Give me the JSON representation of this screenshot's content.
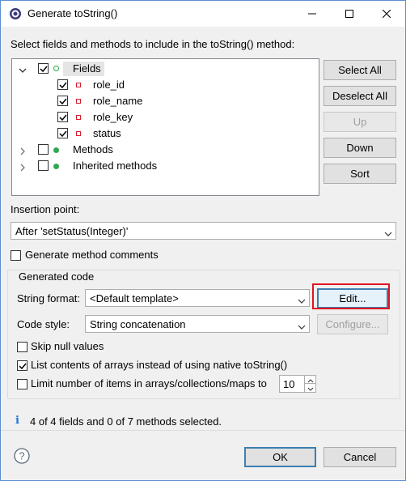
{
  "window": {
    "title": "Generate toString()"
  },
  "instructions": "Select fields and methods to include in the toString() method:",
  "tree": {
    "fields": {
      "label": "Fields",
      "checked": true,
      "expanded": true,
      "children": [
        {
          "label": "role_id",
          "checked": true
        },
        {
          "label": "role_name",
          "checked": true
        },
        {
          "label": "role_key",
          "checked": true
        },
        {
          "label": "status",
          "checked": true
        }
      ]
    },
    "methods": {
      "label": "Methods",
      "checked": false,
      "expanded": false
    },
    "inherited": {
      "label": "Inherited methods",
      "checked": false,
      "expanded": false
    }
  },
  "side_buttons": {
    "select_all": "Select All",
    "deselect_all": "Deselect All",
    "up": "Up",
    "down": "Down",
    "sort": "Sort"
  },
  "insertion": {
    "label": "Insertion point:",
    "value": "After 'setStatus(Integer)'"
  },
  "generate_comments": {
    "label": "Generate method comments",
    "checked": false
  },
  "generated_code": {
    "title": "Generated code",
    "string_format_label": "String format:",
    "string_format_value": "<Default template>",
    "edit_label": "Edit...",
    "code_style_label": "Code style:",
    "code_style_value": "String concatenation",
    "configure_label": "Configure...",
    "skip_null": {
      "label": "Skip null values",
      "checked": false
    },
    "list_arrays": {
      "label": "List contents of arrays instead of using native toString()",
      "checked": true
    },
    "limit_items": {
      "label": "Limit number of items in arrays/collections/maps to",
      "checked": false
    },
    "limit_value": "10"
  },
  "status": {
    "text": "4 of 4 fields and 0 of 7 methods selected.",
    "icon": "info-icon"
  },
  "footer": {
    "ok": "OK",
    "cancel": "Cancel",
    "help_icon": "help-icon"
  },
  "colors": {
    "highlight": "#e0151f",
    "accent_border": "#3c7fb1",
    "info": "#1e6fd9"
  }
}
